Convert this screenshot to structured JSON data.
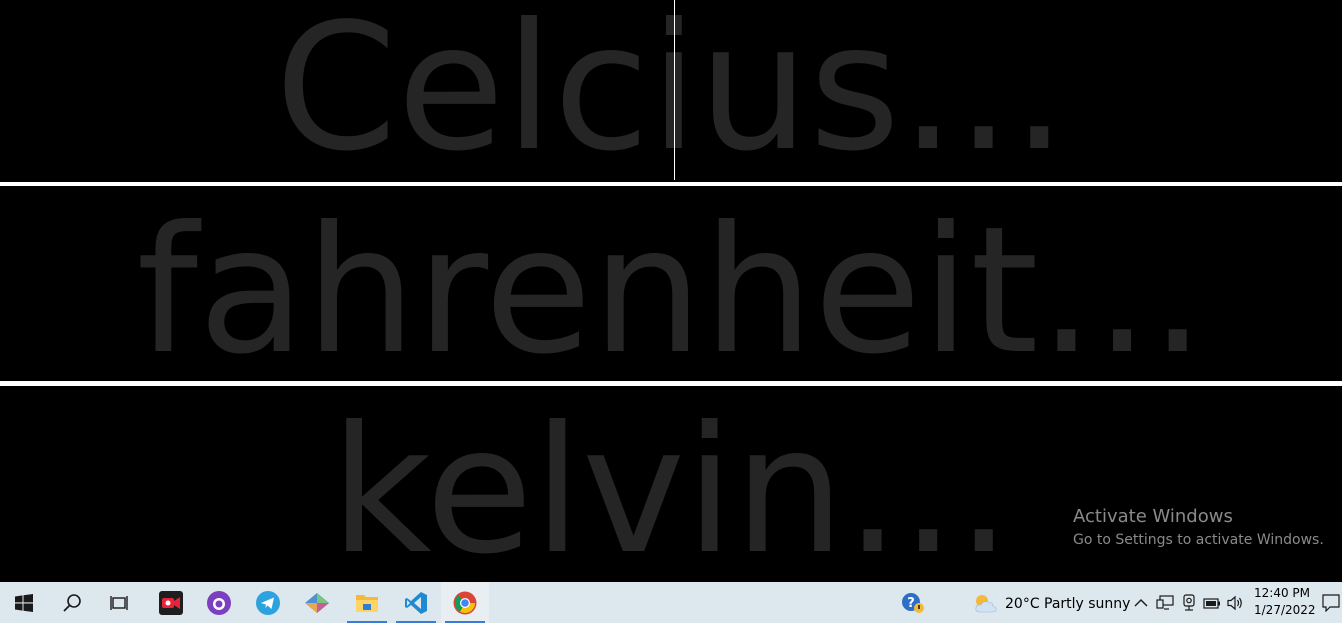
{
  "fields": {
    "celsius_placeholder": "Celcius...",
    "fahrenheit_placeholder": "fahrenheit...",
    "kelvin_placeholder": "kelvin..."
  },
  "watermark": {
    "title": "Activate Windows",
    "subtitle": "Go to Settings to activate Windows."
  },
  "taskbar": {
    "apps": [
      "start-icon",
      "search-icon",
      "task-view-icon",
      "screen-recorder-icon",
      "github-desktop-icon",
      "telegram-icon",
      "sourcetree-icon",
      "file-explorer-icon",
      "vscode-icon",
      "chrome-icon"
    ],
    "weather": {
      "temp": "20°C",
      "condition": "Partly sunny"
    },
    "clock": {
      "time": "12:40 PM",
      "date": "1/27/2022"
    }
  },
  "colors": {
    "background": "#000000",
    "placeholder": "#252525",
    "separator": "#ffffff",
    "taskbar": "#dde7ee"
  }
}
